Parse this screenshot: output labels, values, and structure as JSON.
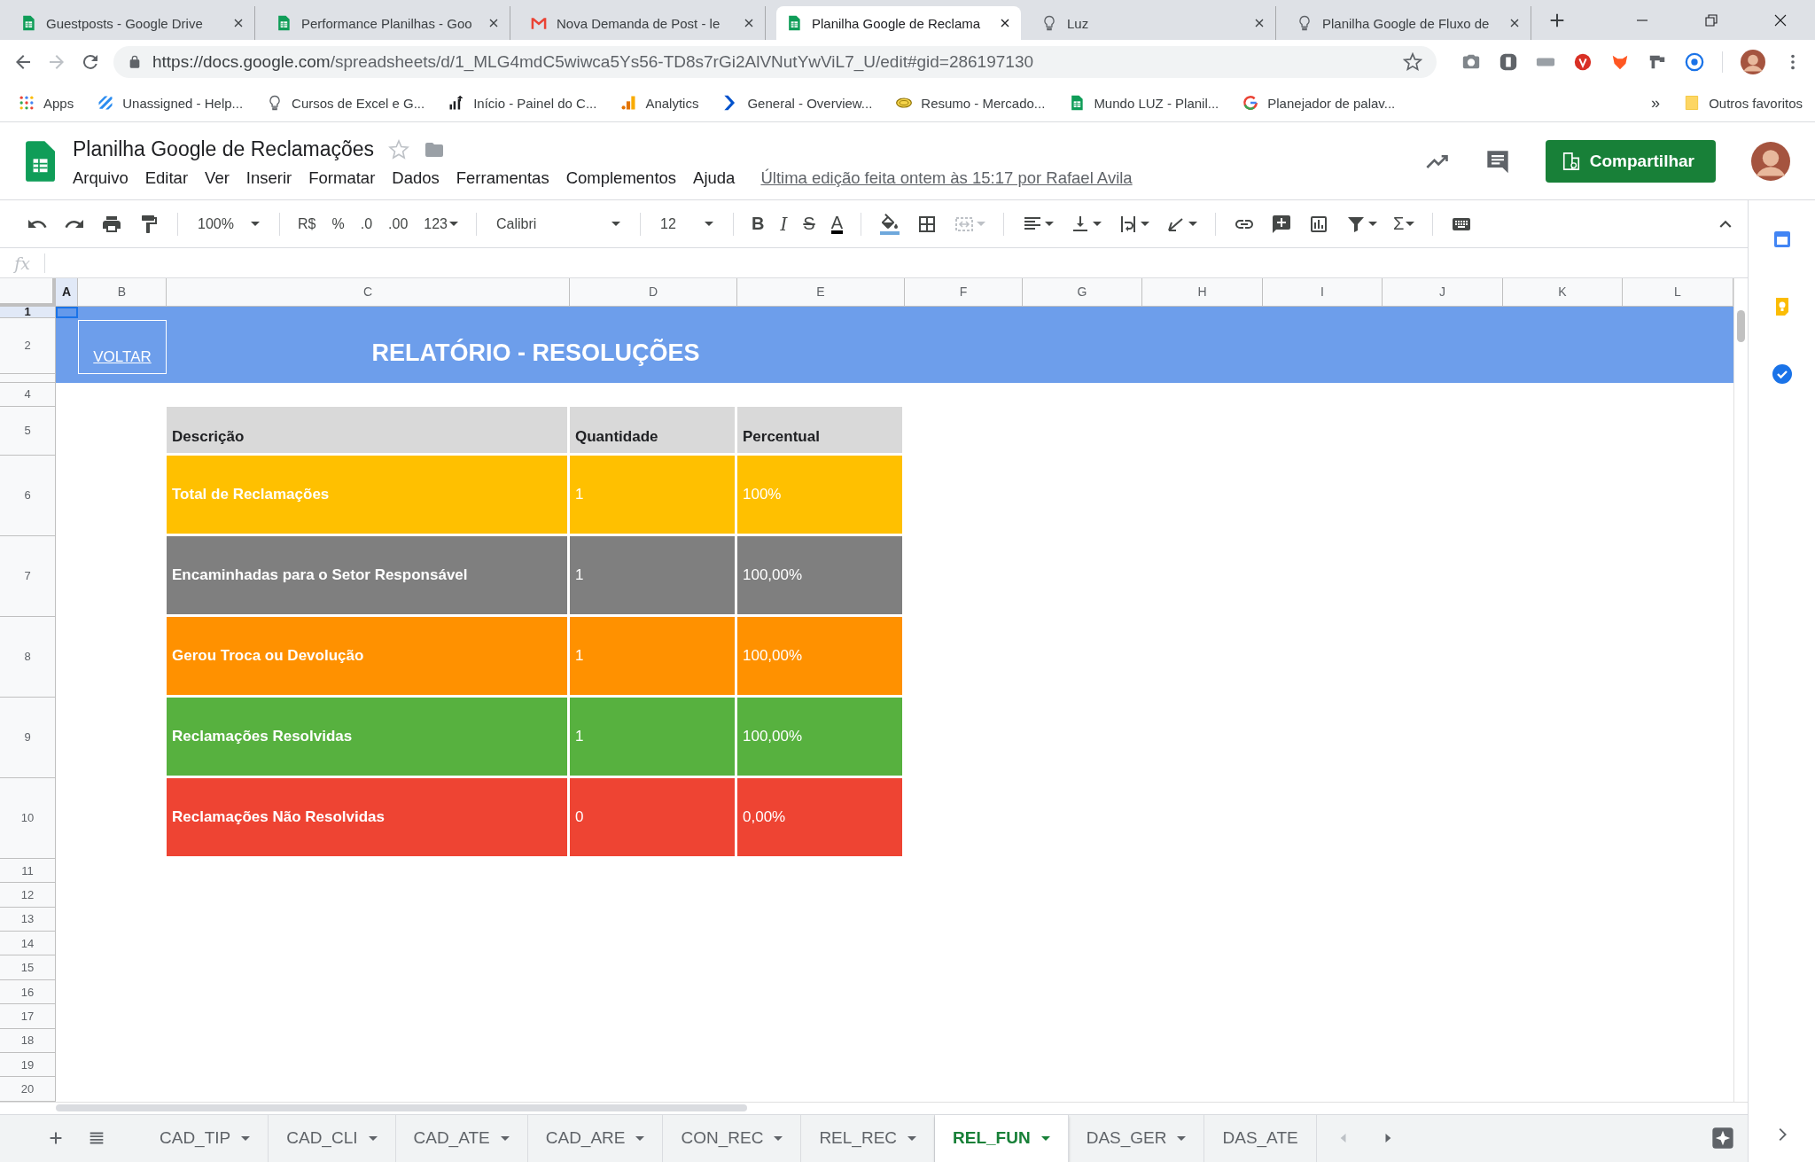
{
  "browser": {
    "tabs": [
      {
        "title": "Guestposts - Google Drive",
        "selected": false
      },
      {
        "title": "Performance Planilhas - Goo",
        "selected": false
      },
      {
        "title": "Nova Demanda de Post - le",
        "selected": false
      },
      {
        "title": "Planilha Google de Reclama",
        "selected": true
      },
      {
        "title": "Luz",
        "selected": false
      },
      {
        "title": "Planilha Google de Fluxo de",
        "selected": false
      }
    ],
    "url_host": "https://docs.google.com",
    "url_path": "/spreadsheets/d/1_MLG4mdC5wiwca5Ys56-TD8s7rGi2AlVNutYwViL7_U/edit#gid=286197130",
    "bookmarks": [
      {
        "label": "Apps"
      },
      {
        "label": "Unassigned - Help..."
      },
      {
        "label": "Cursos de Excel e G..."
      },
      {
        "label": "Início - Painel do C..."
      },
      {
        "label": "Analytics"
      },
      {
        "label": "General - Overview..."
      },
      {
        "label": "Resumo - Mercado..."
      },
      {
        "label": "Mundo LUZ - Planil..."
      },
      {
        "label": "Planejador de palav..."
      }
    ],
    "more": "»",
    "other_bookmarks": "Outros favoritos"
  },
  "doc": {
    "title": "Planilha Google de Reclamações",
    "menus": [
      "Arquivo",
      "Editar",
      "Ver",
      "Inserir",
      "Formatar",
      "Dados",
      "Ferramentas",
      "Complementos",
      "Ajuda"
    ],
    "last_edit": "Última edição feita ontem às 15:17 por Rafael Avila",
    "share": "Compartilhar"
  },
  "toolbar": [
    {
      "kind": "undo"
    },
    {
      "kind": "redo"
    },
    {
      "kind": "print"
    },
    {
      "kind": "paint"
    },
    {
      "kind": "sep"
    },
    {
      "kind": "dropdown",
      "label": "100%"
    },
    {
      "kind": "sep"
    },
    {
      "kind": "text",
      "label": "R$"
    },
    {
      "kind": "text",
      "label": "%"
    },
    {
      "kind": "text",
      "label": ".0"
    },
    {
      "kind": "text",
      "label": ".00"
    },
    {
      "kind": "text",
      "label": "123",
      "caret": true
    },
    {
      "kind": "sep"
    },
    {
      "kind": "dropdown",
      "label": "Calibri"
    },
    {
      "kind": "sep"
    },
    {
      "kind": "dropdown",
      "label": "12"
    },
    {
      "kind": "sep"
    },
    {
      "kind": "bold",
      "label": "B"
    },
    {
      "kind": "italic",
      "label": "I"
    },
    {
      "kind": "strike",
      "label": "S"
    },
    {
      "kind": "textcolor",
      "label": "A"
    },
    {
      "kind": "sep"
    },
    {
      "kind": "fill"
    },
    {
      "kind": "borders"
    },
    {
      "kind": "merge",
      "caret": true,
      "disabled": true
    },
    {
      "kind": "sep"
    },
    {
      "kind": "align",
      "caret": true
    },
    {
      "kind": "valign",
      "caret": true
    },
    {
      "kind": "wrap",
      "caret": true
    },
    {
      "kind": "rotate",
      "caret": true
    },
    {
      "kind": "sep"
    },
    {
      "kind": "link"
    },
    {
      "kind": "comment"
    },
    {
      "kind": "chart"
    },
    {
      "kind": "filter",
      "caret": true
    },
    {
      "kind": "sum",
      "label": "Σ",
      "caret": true
    },
    {
      "kind": "sep"
    },
    {
      "kind": "keyboard"
    }
  ],
  "formula_bar": {
    "label": "fx"
  },
  "columns": [
    {
      "label": "A",
      "selected": true
    },
    {
      "label": "B",
      "selected": false
    },
    {
      "label": "C",
      "selected": false
    },
    {
      "label": "D",
      "selected": false
    },
    {
      "label": "E",
      "selected": false
    },
    {
      "label": "F",
      "selected": false
    },
    {
      "label": "G",
      "selected": false
    },
    {
      "label": "H",
      "selected": false
    },
    {
      "label": "I",
      "selected": false
    },
    {
      "label": "J",
      "selected": false
    },
    {
      "label": "K",
      "selected": false
    },
    {
      "label": "L",
      "selected": false
    }
  ],
  "rows": [
    {
      "label": "1",
      "selected": true
    },
    {
      "label": "2",
      "selected": false
    },
    {
      "label": "4",
      "selected": false
    },
    {
      "label": "5",
      "selected": false
    },
    {
      "label": "6",
      "selected": false
    },
    {
      "label": "7",
      "selected": false
    },
    {
      "label": "8",
      "selected": false
    },
    {
      "label": "9",
      "selected": false
    },
    {
      "label": "10",
      "selected": false
    },
    {
      "label": "11",
      "selected": false
    },
    {
      "label": "12",
      "selected": false
    },
    {
      "label": "13",
      "selected": false
    },
    {
      "label": "14",
      "selected": false
    },
    {
      "label": "15",
      "selected": false
    },
    {
      "label": "16",
      "selected": false
    },
    {
      "label": "17",
      "selected": false
    },
    {
      "label": "18",
      "selected": false
    },
    {
      "label": "19",
      "selected": false
    },
    {
      "label": "20",
      "selected": false
    }
  ],
  "report": {
    "back_link": "VOLTAR",
    "title": "RELATÓRIO - RESOLUÇÕES",
    "header": [
      "Descrição",
      "Quantidade",
      "Percentual"
    ],
    "items": [
      {
        "description": "Total de Reclamações",
        "quantity": "1",
        "percent": "100%",
        "color": "#ffc000"
      },
      {
        "description": "Encaminhadas para o Setor Responsável",
        "quantity": "1",
        "percent": "100,00%",
        "color": "#7f7f7f"
      },
      {
        "description": "Gerou Troca ou Devolução",
        "quantity": "1",
        "percent": "100,00%",
        "color": "#ff9100"
      },
      {
        "description": "Reclamações Resolvidas",
        "quantity": "1",
        "percent": "100,00%",
        "color": "#57b13f"
      },
      {
        "description": "Reclamações Não Resolvidas",
        "quantity": "0",
        "percent": "0,00%",
        "color": "#ee4433"
      }
    ]
  },
  "sheet_tabs": [
    {
      "label": "CAD_TIP",
      "selected": false,
      "caret": true
    },
    {
      "label": "CAD_CLI",
      "selected": false,
      "caret": true
    },
    {
      "label": "CAD_ATE",
      "selected": false,
      "caret": true
    },
    {
      "label": "CAD_ARE",
      "selected": false,
      "caret": true
    },
    {
      "label": "CON_REC",
      "selected": false,
      "caret": true
    },
    {
      "label": "REL_REC",
      "selected": false,
      "caret": true
    },
    {
      "label": "REL_FUN",
      "selected": true,
      "caret": true
    },
    {
      "label": "DAS_GER",
      "selected": false,
      "caret": true
    },
    {
      "label": "DAS_ATE",
      "selected": false,
      "caret": false
    }
  ]
}
